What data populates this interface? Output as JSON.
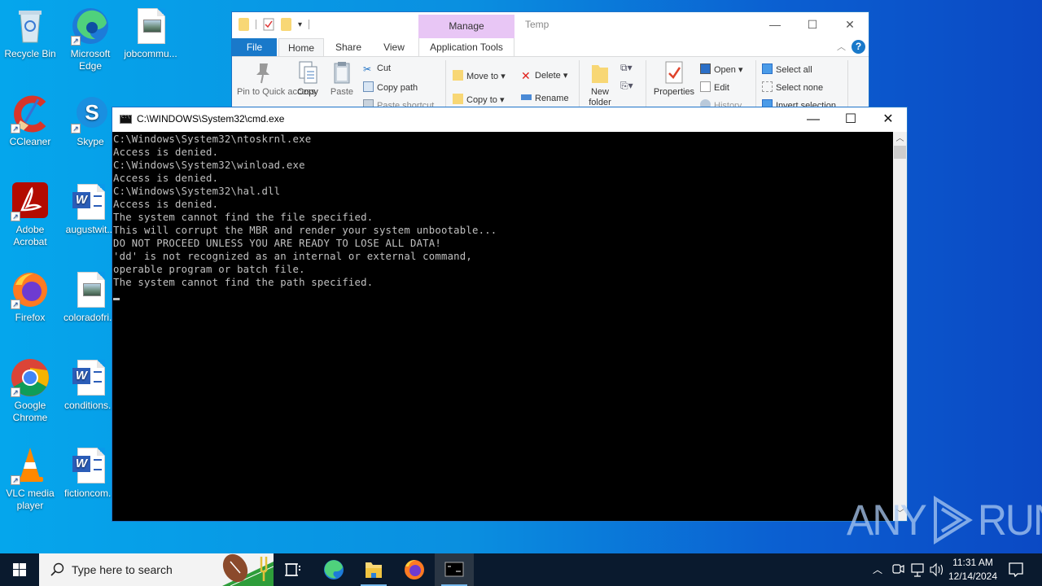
{
  "desktop": {
    "icons": [
      {
        "label": "Recycle Bin",
        "icon": "recycle-bin-icon"
      },
      {
        "label": "Microsoft Edge",
        "icon": "edge-icon"
      },
      {
        "label": "jobcommu...",
        "icon": "image-file-icon"
      },
      {
        "label": "CCleaner",
        "icon": "ccleaner-icon"
      },
      {
        "label": "Skype",
        "icon": "skype-icon"
      },
      {
        "label": "Adobe Acrobat",
        "icon": "acrobat-icon"
      },
      {
        "label": "augustwit...",
        "icon": "word-doc-icon"
      },
      {
        "label": "Firefox",
        "icon": "firefox-icon"
      },
      {
        "label": "coloradofri...",
        "icon": "image-file-icon"
      },
      {
        "label": "Google Chrome",
        "icon": "chrome-icon"
      },
      {
        "label": "conditions...",
        "icon": "word-doc-icon"
      },
      {
        "label": "VLC media player",
        "icon": "vlc-icon"
      },
      {
        "label": "fictioncom...",
        "icon": "word-doc-icon"
      }
    ]
  },
  "explorer": {
    "title": "Temp",
    "context_tab": "Manage",
    "tabs": [
      "File",
      "Home",
      "Share",
      "View",
      "Application Tools"
    ],
    "ribbon": {
      "pin": "Pin to Quick access",
      "copy": "Copy",
      "paste": "Paste",
      "cut": "Cut",
      "copy_path": "Copy path",
      "paste_shortcut": "Paste shortcut",
      "move_to": "Move to",
      "copy_to": "Copy to",
      "delete": "Delete",
      "rename": "Rename",
      "new_folder": "New folder",
      "properties": "Properties",
      "open": "Open",
      "edit": "Edit",
      "history": "History",
      "select_all": "Select all",
      "select_none": "Select none",
      "invert_selection": "Invert selection"
    }
  },
  "cmd": {
    "title": "C:\\WINDOWS\\System32\\cmd.exe",
    "lines": [
      "C:\\Windows\\System32\\ntoskrnl.exe",
      "Access is denied.",
      "C:\\Windows\\System32\\winload.exe",
      "Access is denied.",
      "C:\\Windows\\System32\\hal.dll",
      "Access is denied.",
      "The system cannot find the file specified.",
      "This will corrupt the MBR and render your system unbootable...",
      "DO NOT PROCEED UNLESS YOU ARE READY TO LOSE ALL DATA!",
      "'dd' is not recognized as an internal or external command,",
      "operable program or batch file.",
      "The system cannot find the path specified."
    ]
  },
  "watermark": {
    "left": "ANY",
    "right": "RUN"
  },
  "taskbar": {
    "search_placeholder": "Type here to search",
    "apps": [
      "Task View",
      "Microsoft Edge",
      "File Explorer",
      "Firefox",
      "Command Prompt"
    ],
    "clock_time": "11:31 AM",
    "clock_date": "12/14/2024"
  }
}
